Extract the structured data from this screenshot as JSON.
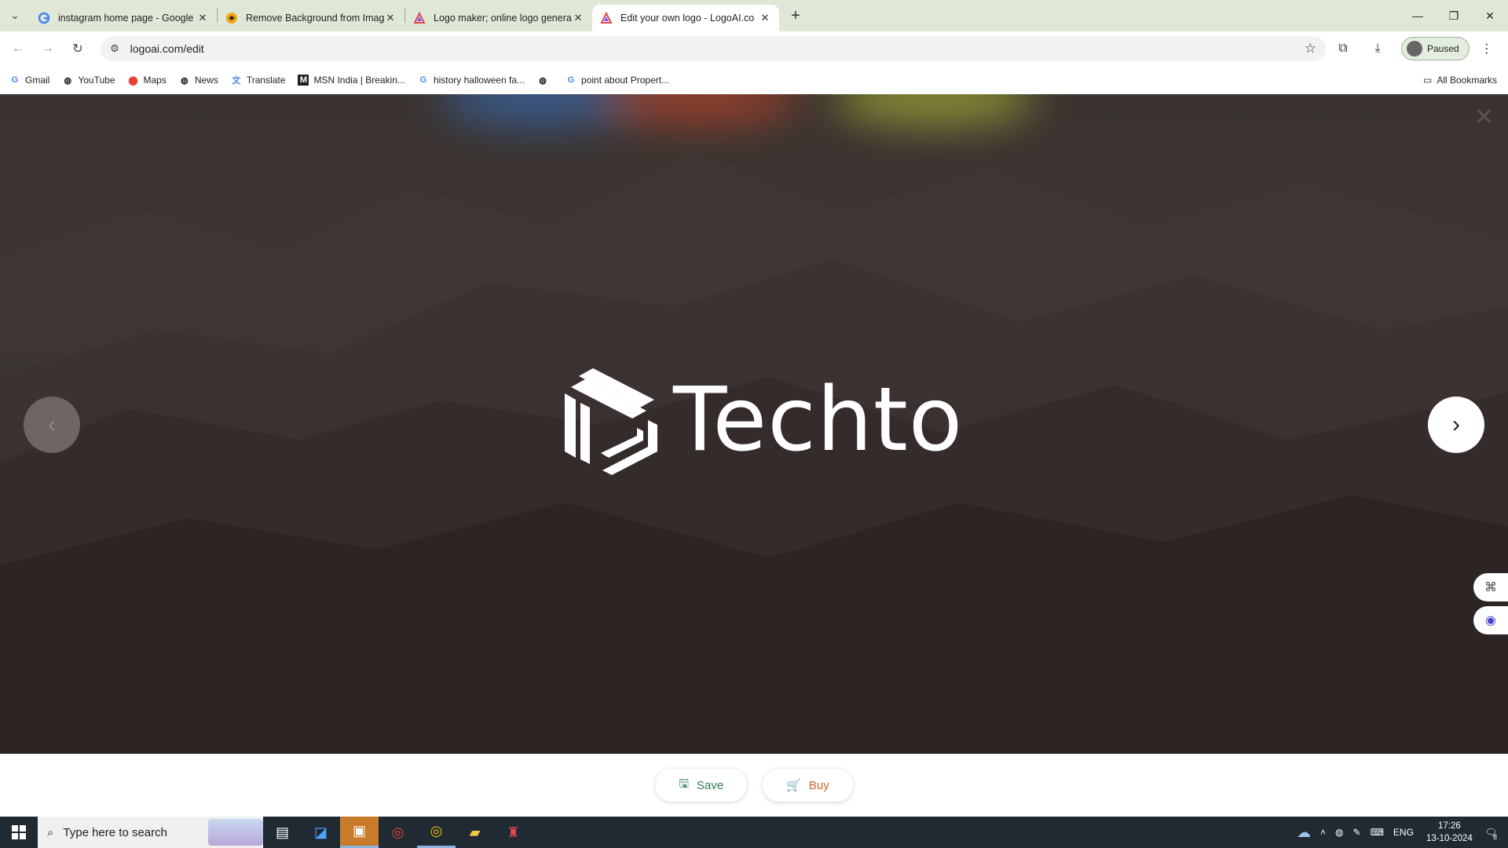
{
  "browser": {
    "tabs": [
      {
        "title": "instagram home page - Google",
        "favicon": "google-icon",
        "active": false
      },
      {
        "title": "Remove Background from Imag",
        "favicon": "removebg-icon",
        "active": false
      },
      {
        "title": "Logo maker; online logo genera",
        "favicon": "logoai-icon",
        "active": false
      },
      {
        "title": "Edit your own logo - LogoAI.co",
        "favicon": "logoai-icon",
        "active": true
      }
    ],
    "url": "logoai.com/edit",
    "profile_label": "Paused",
    "bookmarks": [
      "Gmail",
      "YouTube",
      "Maps",
      "News",
      "Translate",
      "MSN India | Breakin...",
      "history halloween fa...",
      "",
      "point about Propert..."
    ],
    "all_bookmarks": "All Bookmarks"
  },
  "editor": {
    "logo_text": "Techto",
    "actions": {
      "save": "Save",
      "buy": "Buy"
    },
    "colors": {
      "save": "#2e7d4f",
      "buy": "#d7632a",
      "logo": "#ffffff"
    }
  },
  "taskbar": {
    "search_placeholder": "Type here to search",
    "language": "ENG",
    "time": "17:26",
    "date": "13-10-2024",
    "notification_count": "8"
  }
}
